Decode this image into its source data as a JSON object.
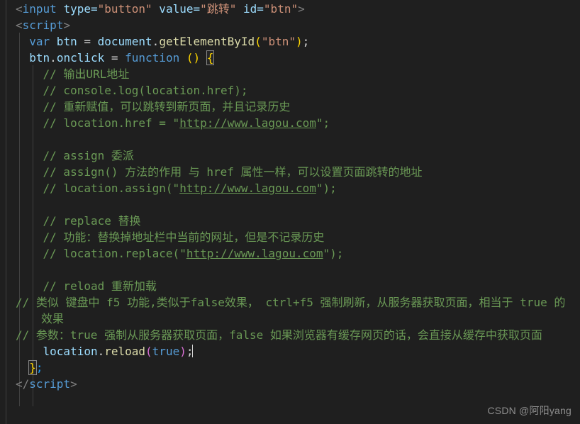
{
  "editor": {
    "background_color": "#1f1f1f",
    "foreground_color": "#d4d4d4",
    "language": "html",
    "font_size_px": 16,
    "line_height_px": 23
  },
  "colors": {
    "tag": "#569cd6",
    "attribute": "#9cdcfe",
    "string": "#ce9178",
    "keyword": "#569cd6",
    "function": "#dcdcaa",
    "comment": "#6a9955",
    "bracket_yellow": "#ffd700",
    "bracket_purple": "#da70d6",
    "bracket_blue": "#179fff",
    "indent_guide": "#404040",
    "watermark": "#8e8e8e"
  },
  "code": {
    "line1": {
      "open": "<",
      "tag": "input",
      "attr1": " type=",
      "val1": "\"button\"",
      "attr2": " value=",
      "val2": "\"跳转\"",
      "attr3": " id=",
      "val3": "\"btn\"",
      "close": ">"
    },
    "line2": {
      "open": "<",
      "tag": "script",
      "close": ">"
    },
    "line3": {
      "kw": "var",
      "name": " btn ",
      "eq": "= ",
      "obj": "document",
      "dot": ".",
      "fn": "getElementById",
      "paren_open": "(",
      "arg": "\"btn\"",
      "paren_close": ")",
      "semi": ";"
    },
    "line4": {
      "obj": "btn",
      "dot": ".",
      "prop": "onclick",
      "eq": " = ",
      "kw": "function",
      "space": " ",
      "paren_open": "(",
      "paren_close": ")",
      "space2": " ",
      "brace": "{"
    },
    "c1": "// 输出URL地址",
    "c2_pre": "// console.log(location.href);",
    "c3": "// 重新赋值，可以跳转到新页面，并且记录历史",
    "c4_pre": "// location.href = \"",
    "c4_link": "http://www.lagou.com",
    "c4_post": "\";",
    "c5": "// assign 委派",
    "c6": "// assign() 方法的作用 与 href 属性一样，可以设置页面跳转的地址",
    "c7_pre": "// location.assign(\"",
    "c7_link": "http://www.lagou.com",
    "c7_post": "\");",
    "c8": "// replace 替换",
    "c9": "// 功能：替换掉地址栏中当前的网址，但是不记录历史",
    "c10_pre": "// location.replace(\"",
    "c10_link": "http://www.lagou.com",
    "c10_post": "\");",
    "c11": "// reload 重新加载",
    "c12": "// 类似 键盘中 f5 功能,类似于false效果， ctrl+f5 强制刷新，从服务器获取页面，相当于 true 的效果",
    "c13": "// 参数：true 强制从服务器获取页面，false 如果浏览器有缓存网页的话，会直接从缓存中获取页面",
    "line_reload": {
      "obj": "location",
      "dot": ".",
      "fn": "reload",
      "paren_open": "(",
      "arg": "true",
      "paren_close": ")",
      "semi": ";"
    },
    "line_close_fn": {
      "brace": "}",
      "semi": ";"
    },
    "line_close_script": {
      "open": "</",
      "tag": "script",
      "close": ">"
    }
  },
  "watermark": {
    "text": "CSDN @阿阳yang"
  }
}
